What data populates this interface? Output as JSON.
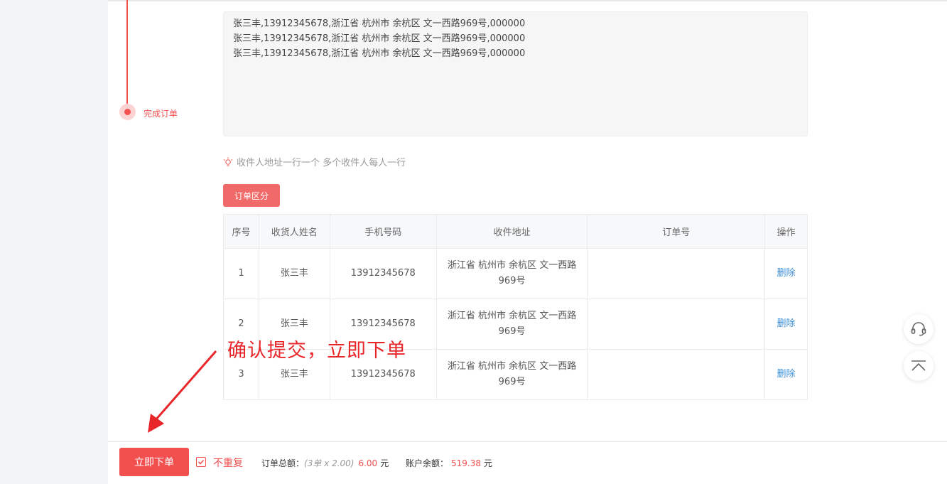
{
  "steps": {
    "complete_label": "完成订单"
  },
  "address_input": {
    "value": "张三丰,13912345678,浙江省 杭州市 余杭区 文一西路969号,000000\n张三丰,13912345678,浙江省 杭州市 余杭区 文一西路969号,000000\n张三丰,13912345678,浙江省 杭州市 余杭区 文一西路969号,000000"
  },
  "hint": {
    "text": "收件人地址一行一个 多个收件人每人一行",
    "icon": "lightbulb-icon"
  },
  "split_button": {
    "label": "订单区分"
  },
  "table": {
    "headers": [
      "序号",
      "收货人姓名",
      "手机号码",
      "收件地址",
      "订单号",
      "操作"
    ],
    "rows": [
      {
        "index": "1",
        "name": "张三丰",
        "phone": "13912345678",
        "address": "浙江省 杭州市 余杭区 文一西路969号",
        "order_no": "",
        "action": "删除"
      },
      {
        "index": "2",
        "name": "张三丰",
        "phone": "13912345678",
        "address": "浙江省 杭州市 余杭区 文一西路969号",
        "order_no": "",
        "action": "删除"
      },
      {
        "index": "3",
        "name": "张三丰",
        "phone": "13912345678",
        "address": "浙江省 杭州市 余杭区 文一西路969号",
        "order_no": "",
        "action": "删除"
      }
    ]
  },
  "annotation": {
    "text": "确认提交，立即下单"
  },
  "float_buttons": {
    "service_icon": "headset-icon",
    "top_icon": "back-to-top-icon"
  },
  "bottom": {
    "submit_label": "立即下单",
    "no_repeat_label": "不重复",
    "no_repeat_checked": true,
    "total_label": "订单总额：",
    "total_detail": "(3单 x 2.00)",
    "total_amount": "6.00",
    "currency": "元",
    "balance_label": "账户余额：",
    "balance_amount": "519.38"
  },
  "colors": {
    "accent": "#f24f4f",
    "link": "#3b8fd6"
  }
}
